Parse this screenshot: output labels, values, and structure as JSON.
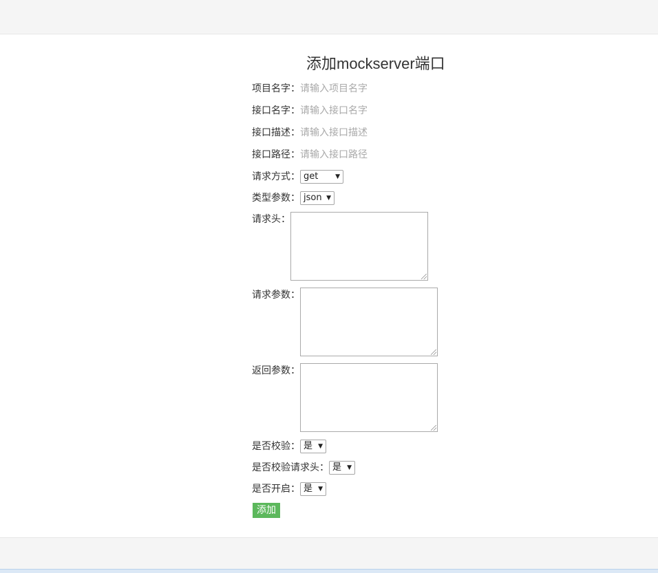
{
  "header": {},
  "page_title": "添加mockserver端口",
  "form": {
    "project_name": {
      "label": "项目名字：",
      "placeholder": "请输入项目名字",
      "value": ""
    },
    "api_name": {
      "label": "接口名字：",
      "placeholder": "请输入接口名字",
      "value": ""
    },
    "api_desc": {
      "label": "接口描述：",
      "placeholder": "请输入接口描述",
      "value": ""
    },
    "api_path": {
      "label": "接口路径：",
      "placeholder": "请输入接口路径",
      "value": ""
    },
    "method": {
      "label": "请求方式：",
      "selected": "get"
    },
    "param_type": {
      "label": "类型参数：",
      "selected": "json"
    },
    "req_headers": {
      "label": "请求头：",
      "value": ""
    },
    "req_params": {
      "label": "请求参数：",
      "value": ""
    },
    "resp_params": {
      "label": "返回参数：",
      "value": ""
    },
    "check": {
      "label": "是否校验：",
      "selected": "是"
    },
    "check_headers": {
      "label": "是否校验请求头：",
      "selected": "是"
    },
    "enabled": {
      "label": "是否开启：",
      "selected": "是"
    },
    "submit_label": "添加"
  },
  "colors": {
    "bar_background": "#f5f5f5",
    "button_green": "#5cb85c",
    "placeholder": "#a9a9a9"
  }
}
